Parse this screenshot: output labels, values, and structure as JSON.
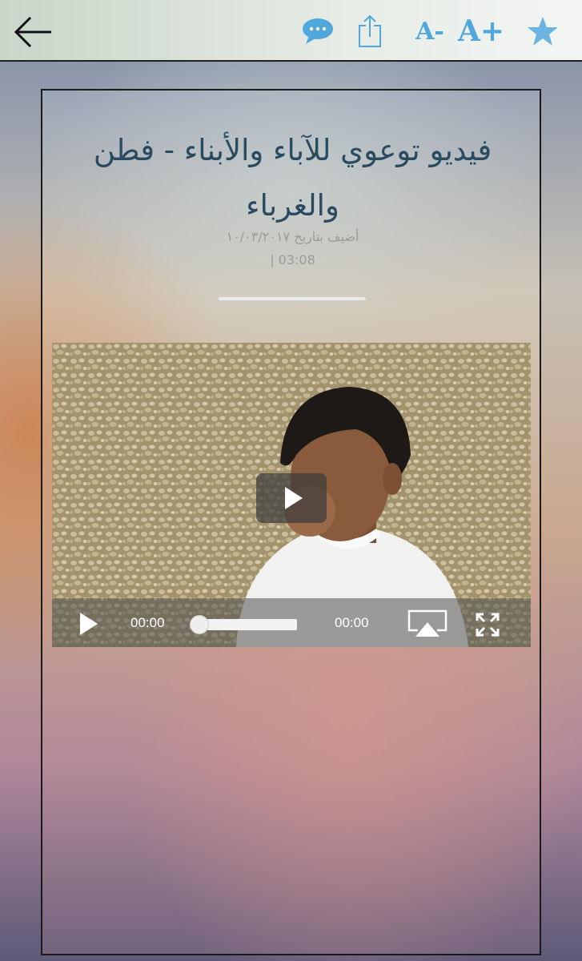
{
  "toolbar": {
    "back": "back-arrow-icon",
    "comments": "comments-icon",
    "share": "share-icon",
    "font_decrease": "A-",
    "font_increase": "A+",
    "favorite": "star-icon",
    "accent_color": "#4fa7dc"
  },
  "article": {
    "title": "فيديو توعوي للآباء والأبناء - فطن والغرباء",
    "date_line": "أضيف بتاريخ ١٠/٠٣/٢٠١٧",
    "time_line": "| 03:08"
  },
  "video": {
    "current_time": "00:00",
    "duration": "00:00",
    "progress": 0
  }
}
